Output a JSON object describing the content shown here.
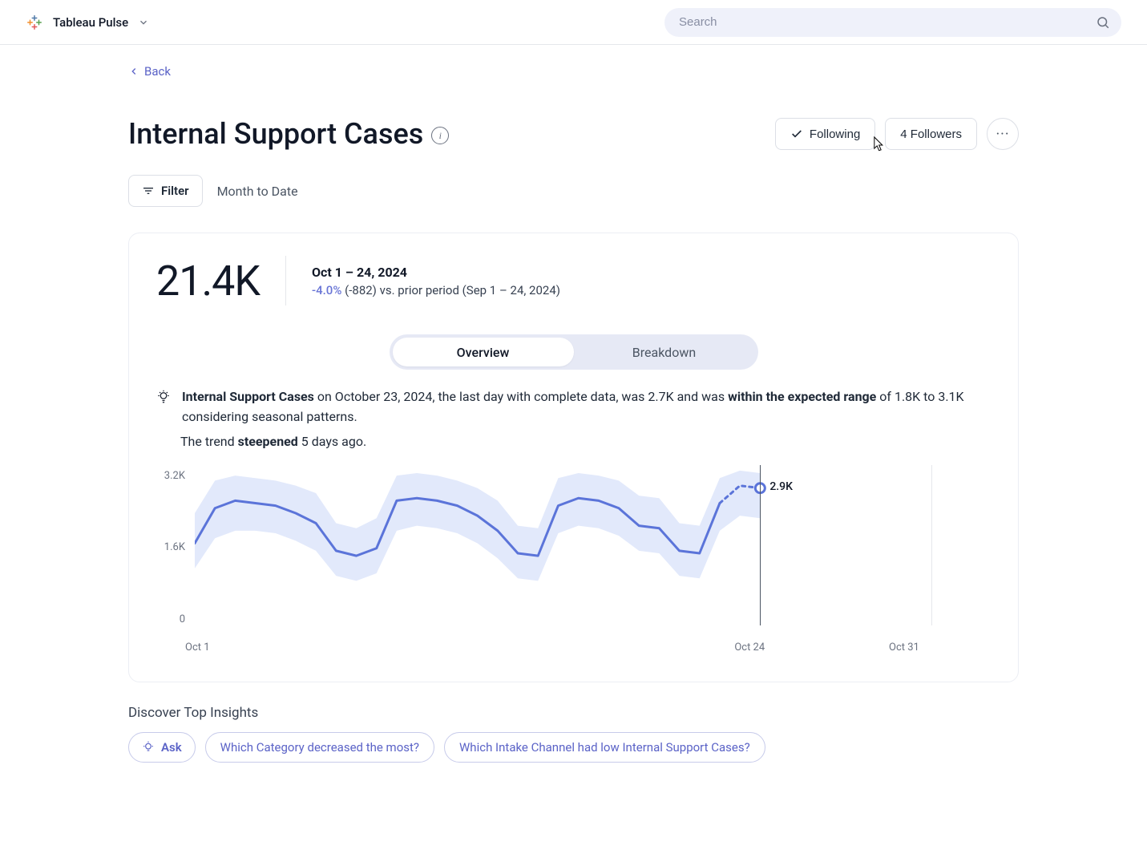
{
  "header": {
    "brand": "Tableau Pulse",
    "search_placeholder": "Search"
  },
  "nav": {
    "back_label": "Back"
  },
  "title": {
    "text": "Internal Support Cases",
    "following_label": "Following",
    "followers_label": "4 Followers"
  },
  "filter": {
    "button_label": "Filter",
    "period": "Month to Date"
  },
  "summary": {
    "value": "21.4K",
    "date_range": "Oct 1 – 24, 2024",
    "delta_pct": "-4.0%",
    "delta_rest": " (-882) vs. prior period (Sep 1 – 24, 2024)"
  },
  "tabs": {
    "overview": "Overview",
    "breakdown": "Breakdown"
  },
  "insight": {
    "metric_bold": "Internal Support Cases",
    "part1": " on October 23, 2024, the last day with complete data, was 2.7K and was ",
    "range_bold": "within the expected range",
    "part2": " of 1.8K to 3.1K considering seasonal patterns.",
    "line2_a": "The trend ",
    "line2_bold": "steepened",
    "line2_b": " 5 days ago."
  },
  "chart_data": {
    "type": "line",
    "title": "",
    "yticks": [
      "3.2K",
      "1.6K",
      "0"
    ],
    "ylim": [
      0,
      3200
    ],
    "xticks": [
      "Oct 1",
      "Oct 24",
      "Oct 31"
    ],
    "today_index": 23,
    "end_index": 30,
    "point_label": "2.9K",
    "series": [
      {
        "name": "actual",
        "values": [
          1800,
          2500,
          2650,
          2600,
          2550,
          2400,
          2200,
          1650,
          1550,
          1700,
          2650,
          2700,
          2650,
          2550,
          2350,
          2050,
          1600,
          1550,
          2550,
          2700,
          2650,
          2500,
          2150,
          2100,
          1650,
          1600,
          2600,
          2950,
          2900
        ],
        "stroke": "#5b74d9"
      }
    ],
    "band": {
      "upper": [
        2400,
        3050,
        3150,
        3100,
        3050,
        2950,
        2800,
        2200,
        2100,
        2300,
        3150,
        3200,
        3150,
        3050,
        2900,
        2650,
        2150,
        2100,
        3100,
        3200,
        3150,
        3050,
        2750,
        2700,
        2200,
        2150,
        3100,
        3250,
        3200
      ],
      "lower": [
        1300,
        1900,
        2050,
        2050,
        2000,
        1850,
        1650,
        1150,
        1050,
        1200,
        2050,
        2150,
        2100,
        2000,
        1800,
        1500,
        1100,
        1050,
        2000,
        2150,
        2100,
        1950,
        1650,
        1600,
        1150,
        1100,
        2050,
        2350,
        2300
      ],
      "fill": "#e2e9fb"
    }
  },
  "discover": {
    "heading": "Discover Top Insights",
    "ask_label": "Ask",
    "chips": [
      "Which Category decreased the most?",
      "Which Intake Channel had low Internal Support Cases?"
    ]
  }
}
